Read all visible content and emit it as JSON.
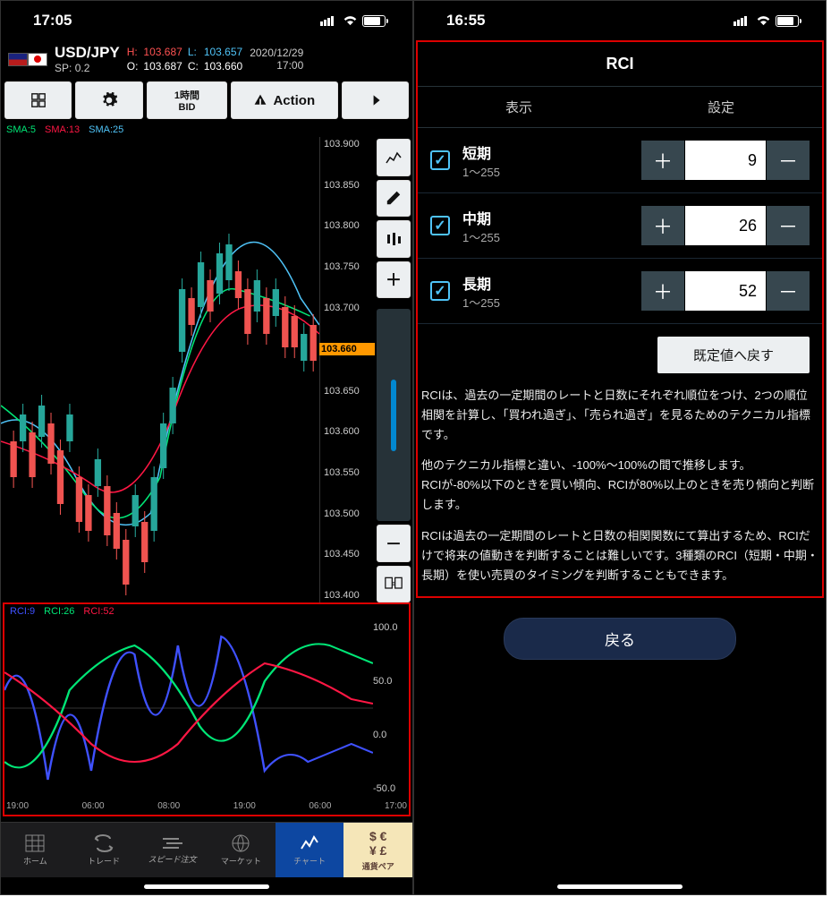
{
  "left": {
    "status_time": "17:05",
    "pair": "USD/JPY",
    "spread_label": "SP:",
    "spread": "0.2",
    "ohlc": {
      "H": "103.687",
      "L": "103.657",
      "O": "103.687",
      "C": "103.660"
    },
    "date": "2020/12/29",
    "time": "17:00",
    "toolbar": {
      "timeframe_l1": "1時間",
      "timeframe_l2": "BID",
      "action": "Action"
    },
    "sma_labels": [
      "SMA:5",
      "SMA:13",
      "SMA:25"
    ],
    "y_ticks": [
      "103.900",
      "103.850",
      "103.800",
      "103.750",
      "103.700",
      "103.650",
      "103.600",
      "103.550",
      "103.500",
      "103.450",
      "103.400"
    ],
    "current_price": "103.660",
    "rci_labels": [
      "RCI:9",
      "RCI:26",
      "RCI:52"
    ],
    "rci_y": [
      "100.0",
      "50.0",
      "0.0",
      "-50.0"
    ],
    "x_times": [
      "19:00",
      "06:00",
      "08:00",
      "19:00",
      "06:00",
      "17:00"
    ],
    "nav": [
      "ホーム",
      "トレード",
      "スピード注文",
      "マーケット",
      "チャート",
      "通貨ペア"
    ]
  },
  "right": {
    "status_time": "16:55",
    "title": "RCI",
    "tabs": [
      "表示",
      "設定"
    ],
    "rows": [
      {
        "label": "短期",
        "range": "1〜255",
        "value": "9"
      },
      {
        "label": "中期",
        "range": "1〜255",
        "value": "26"
      },
      {
        "label": "長期",
        "range": "1〜255",
        "value": "52"
      }
    ],
    "reset": "既定値へ戻す",
    "desc1": "RCIは、過去の一定期間のレートと日数にそれぞれ順位をつけ、2つの順位相関を計算し、「買われ過ぎ」、「売られ過ぎ」を見るためのテクニカル指標です。",
    "desc2": "他のテクニカル指標と違い、-100%〜100%の間で推移します。\nRCIが-80%以下のときを買い傾向、RCIが80%以上のときを売り傾向と判断します。",
    "desc3": "RCIは過去の一定期間のレートと日数の相関関数にて算出するため、RCIだけで将来の値動きを判断することは難しいです。3種類のRCI（短期・中期・長期）を使い売買のタイミングを判断することもできます。",
    "back": "戻る"
  },
  "chart_data": {
    "type": "line",
    "title": "USD/JPY 1H candlestick + RCI oscillator",
    "main": {
      "type": "candlestick",
      "ylim": [
        103.4,
        103.9
      ],
      "current_close": 103.66,
      "sma_periods": [
        5,
        13,
        25
      ]
    },
    "rci": {
      "type": "line",
      "ylim": [
        -100,
        100
      ],
      "x": [
        "19:00",
        "06:00",
        "08:00",
        "19:00",
        "06:00",
        "17:00"
      ],
      "series": [
        {
          "name": "RCI:9",
          "color": "#3f51ff",
          "values": [
            20,
            80,
            -90,
            60,
            -80,
            90,
            -70,
            20,
            90,
            -60
          ]
        },
        {
          "name": "RCI:26",
          "color": "#00e676",
          "values": [
            -60,
            -90,
            20,
            80,
            60,
            -20,
            -70,
            30,
            90,
            70
          ]
        },
        {
          "name": "RCI:52",
          "color": "#ff1744",
          "values": [
            50,
            20,
            -40,
            -80,
            -40,
            30,
            60,
            50,
            30,
            10
          ]
        }
      ]
    }
  }
}
